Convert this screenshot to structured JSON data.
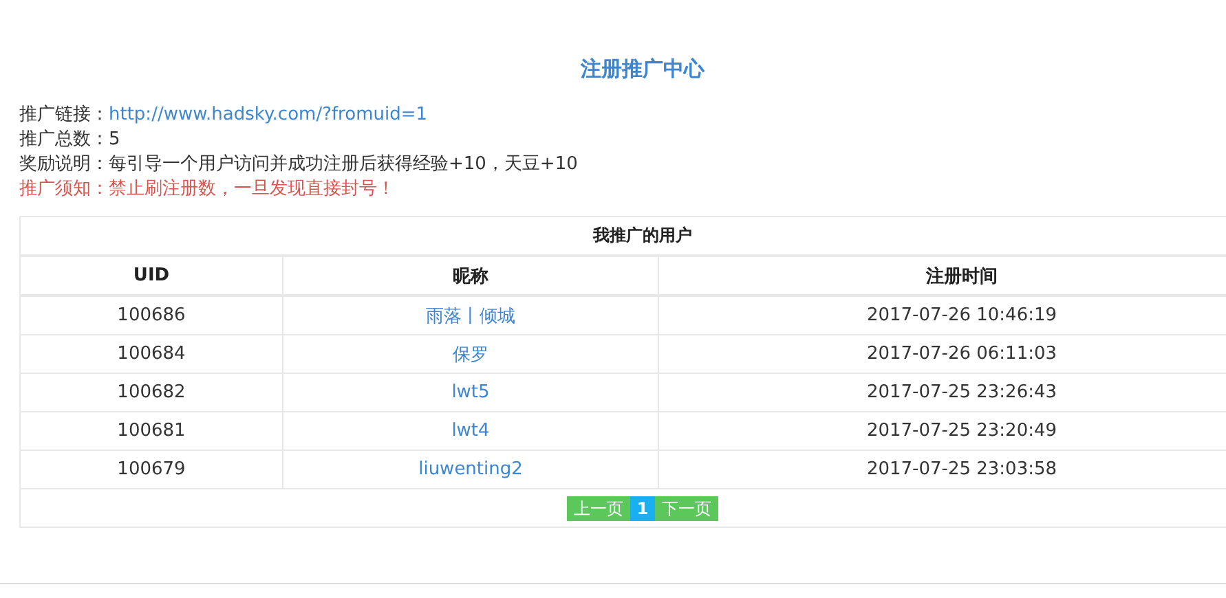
{
  "title": "注册推广中心",
  "info": [
    {
      "kind": "link",
      "label": "推广链接：",
      "value": "http://www.hadsky.com/?fromuid=1"
    },
    {
      "kind": "text",
      "label": "推广总数：",
      "value": "5"
    },
    {
      "kind": "text",
      "label": "奖励说明：",
      "value": "每引导一个用户访问并成功注册后获得经验+10，天豆+10"
    },
    {
      "kind": "warning",
      "label": "推广须知：",
      "value": "禁止刷注册数，一旦发现直接封号！"
    }
  ],
  "table": {
    "caption": "我推广的用户",
    "columns": [
      "UID",
      "昵称",
      "注册时间"
    ],
    "rows": [
      [
        "100686",
        "雨落丨倾城",
        "2017-07-26 10:46:19"
      ],
      [
        "100684",
        "保罗",
        "2017-07-26 06:11:03"
      ],
      [
        "100682",
        "lwt5",
        "2017-07-25 23:26:43"
      ],
      [
        "100681",
        "lwt4",
        "2017-07-25 23:20:49"
      ],
      [
        "100679",
        "liuwenting2",
        "2017-07-25 23:03:58"
      ]
    ]
  },
  "pagination": {
    "prev": "上一页",
    "pages": [
      {
        "label": "1",
        "selected": true
      }
    ],
    "next": "下一页"
  }
}
